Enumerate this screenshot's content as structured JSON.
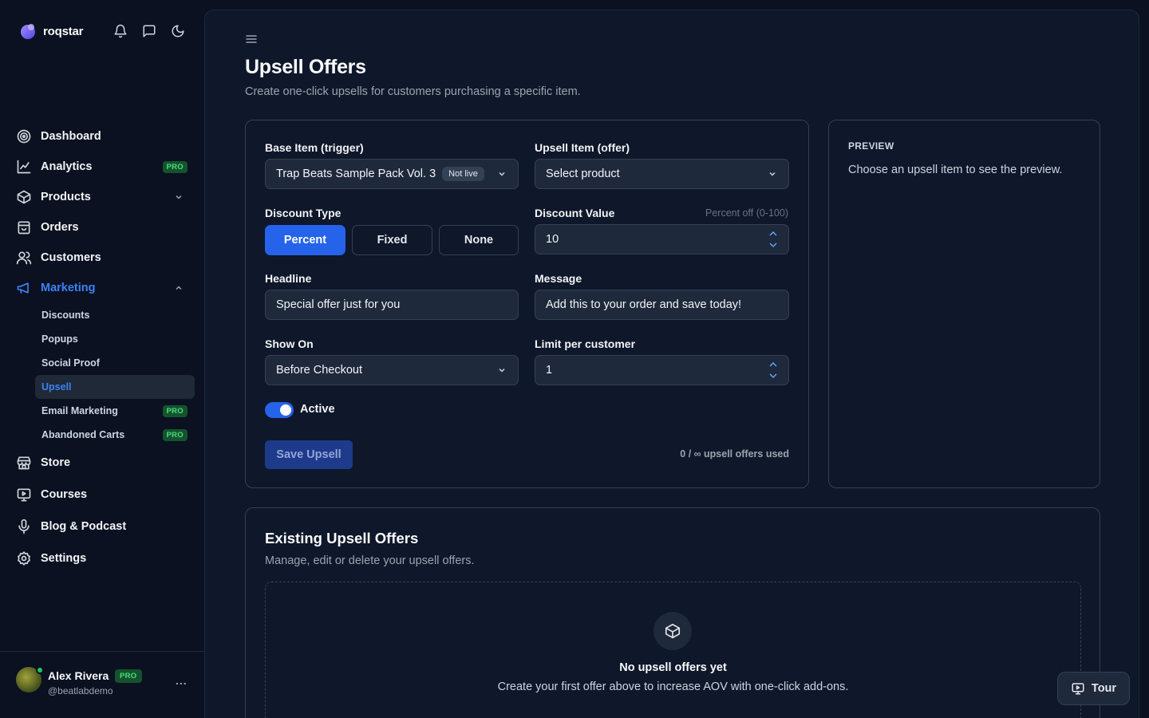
{
  "brand": {
    "name": "roqstar"
  },
  "nav": {
    "dashboard": "Dashboard",
    "analytics": "Analytics",
    "products": "Products",
    "orders": "Orders",
    "customers": "Customers",
    "marketing": "Marketing",
    "store": "Store",
    "courses": "Courses",
    "blog": "Blog & Podcast",
    "settings": "Settings",
    "pro_badge": "PRO"
  },
  "subnav": {
    "discounts": "Discounts",
    "popups": "Popups",
    "social_proof": "Social Proof",
    "upsell": "Upsell",
    "email_marketing": "Email Marketing",
    "abandoned_carts": "Abandoned Carts"
  },
  "user": {
    "name": "Alex Rivera",
    "badge": "PRO",
    "handle": "@beatlabdemo",
    "more": "..."
  },
  "page": {
    "title": "Upsell Offers",
    "subtitle": "Create one-click upsells for customers purchasing a specific item."
  },
  "form": {
    "base_label": "Base Item (trigger)",
    "base_value": "Trap Beats Sample Pack Vol. 3",
    "base_tag": "Not live",
    "upsell_label": "Upsell Item (offer)",
    "upsell_value": "Select product",
    "discount_type_label": "Discount Type",
    "discount_types": [
      "Percent",
      "Fixed",
      "None"
    ],
    "discount_type_selected": "Percent",
    "discount_value_label": "Discount Value",
    "discount_value_hint": "Percent off (0-100)",
    "discount_value": "10",
    "headline_label": "Headline",
    "headline_value": "Special offer just for you",
    "message_label": "Message",
    "message_value": "Add this to your order and save today!",
    "show_on_label": "Show On",
    "show_on_value": "Before Checkout",
    "limit_label": "Limit per customer",
    "limit_value": "1",
    "active_label": "Active",
    "active": true,
    "save_label": "Save Upsell",
    "usage_text": "0 / ∞ upsell offers used"
  },
  "preview": {
    "title": "PREVIEW",
    "text": "Choose an upsell item to see the preview."
  },
  "existing": {
    "title": "Existing Upsell Offers",
    "subtitle": "Manage, edit or delete your upsell offers.",
    "empty_title": "No upsell offers yet",
    "empty_sub": "Create your first offer above to increase AOV with one-click add-ons."
  },
  "tour": {
    "label": "Tour"
  },
  "colors": {
    "accent": "#2563eb",
    "pro_bg": "#14532d",
    "pro_fg": "#4ade80",
    "online": "#22c55e"
  },
  "icons": [
    "logo-icon",
    "bell-icon",
    "chat-icon",
    "moon-icon",
    "dashboard-icon",
    "analytics-icon",
    "products-icon",
    "orders-icon",
    "customers-icon",
    "marketing-icon",
    "store-icon",
    "courses-icon",
    "blog-icon",
    "settings-icon",
    "menu-icon",
    "chevron-down-icon",
    "spinner-icon",
    "box-icon",
    "tour-icon"
  ]
}
